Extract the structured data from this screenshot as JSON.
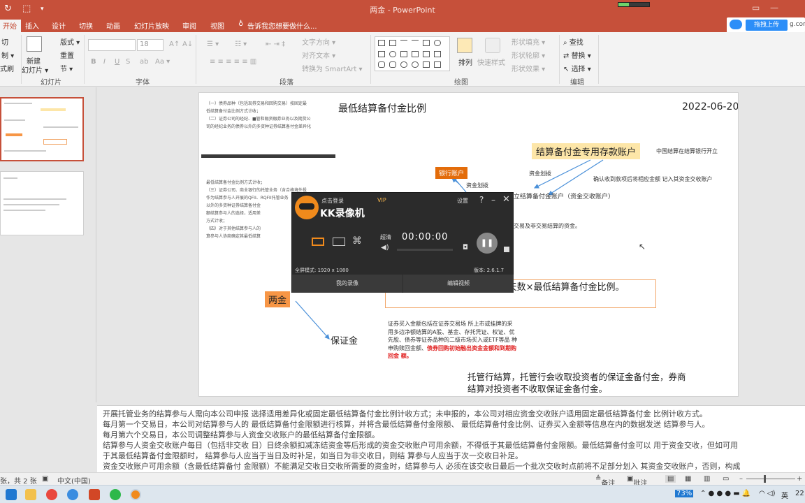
{
  "window": {
    "title": "两金 - PowerPoint",
    "minimize_icon": "minimize-icon",
    "maximize_icon": "maximize-icon",
    "close_icon": "close-icon"
  },
  "ribbon_tabs": [
    "开始",
    "插入",
    "设计",
    "切换",
    "动画",
    "幻灯片放映",
    "审阅",
    "视图"
  ],
  "tell_me": "告诉我您想要做什么...",
  "upload_button": "拖拽上传",
  "upload_suffix": "g.com",
  "ribbon": {
    "clipboard": [
      "切",
      "制 ▾",
      "式刷"
    ],
    "new_slide": "新建",
    "new_slide_sub": "幻灯片 ▾",
    "layout": "版式 ▾",
    "reset": "重置",
    "section": "节 ▾",
    "slides_group": "幻灯片",
    "font_size": "18",
    "font_group": "字体",
    "text_direction": "文字方向 ▾",
    "align_text": "对齐文本 ▾",
    "smartart": "转换为 SmartArt ▾",
    "paragraph_group": "段落",
    "arrange": "排列",
    "quick_styles": "快速样式",
    "shape_fill": "形状填充 ▾",
    "shape_outline": "形状轮廓 ▾",
    "shape_effects": "形状效果 ▾",
    "drawing_group": "绘图",
    "find": "查找",
    "replace": "替换 ▾",
    "select": "选择 ▾",
    "editing_group": "编辑",
    "bold": "B",
    "italic": "I",
    "underline": "U",
    "strike": "S",
    "spacing": "ab",
    "case": "Aa ▾"
  },
  "slide": {
    "title": "最低结算备付金比例",
    "date": "2022-06-20",
    "top_left_lines": [
      "（一）债券品种（包括现券交易和回购交易）按固定最",
      "低结算备付金比例方式计收；",
      "（二）证券公司的经纪、■管和融资融券业务以及期货公",
      "司的经纪业务的债券以外的多资种证券结算备付金差异化"
    ],
    "mid_left_lines": [
      "最低结算备付金比例方式计收；",
      "（三）证券公司、商业银行的托管业务（含合格境外投",
      "作为结算参与人开展的QFII、RQFII托管业务",
      "以外的多资种证券结算备付金",
      "额结算参与人的选择，适用差",
      "方式计收；",
      "（四）对于其他结算参与人的",
      "算参与人协商确定其最低结算"
    ],
    "main_box": "结算备付金专用存款账户",
    "right_note_1": "中国结算在结算银行开立",
    "right_note_2": "确认收到款项后将相应金额 记入其资金交收账户",
    "bank_account": "银行账户",
    "fund_transfer_1": "资金划拨",
    "fund_transfer_2": "资金划拨",
    "settlement_account": "立结算备付金账户（资金交收账户）",
    "settlement_note": "交易及非交易结算的资金。",
    "deposit": "两金",
    "formula": "证券买入金额 / 上月交易日历天数×最低结算备付金比例。",
    "margin": "保证金",
    "purchase_note_lines": [
      "证券买入金额包括在证券交易场 所上市或挂牌的采",
      "用多边净额结算的A股、基金、存托凭证、权证、优",
      "先股、债券等证券品种的二级市场买入或ETF等品 种",
      "申购赎回金额、"
    ],
    "purchase_note_red": "债券回购初始融出资金金额和到期购",
    "purchase_note_red_2": "回金 额。",
    "custody_note_lines": [
      "托管行结算，托管行会收取投资者的保证金备付金，券商",
      "结算对投资者不收取保证金备付金。"
    ]
  },
  "recorder": {
    "login": "点击登录",
    "vip": "VIP",
    "settings": "设置",
    "help": "?",
    "name": "KK录像机",
    "quality": "超清",
    "time": "00:00:00",
    "mode": "全屏模式: 1920 x 1080",
    "version": "版本: 2.6.1.7",
    "my_recordings": "我的录像",
    "edit_video": "编辑视频"
  },
  "notes": [
    "开展托管业务的结算参与人需向本公司申报 选择适用差异化或固定最低结算备付金比例计收方式；未申报的，本公司对相应资金交收账户适用固定最低结算备付金 比例计收方式。",
    "每月第一个交易日，本公司对结算参与人的 最低结算备付金限额进行核算，并将含最低结算备付金限额、 最低结算备付金比例、证券买入金额等信息在内的数据发送 结算参与人。",
    "每月第六个交易日，本公司调整结算参与人资金交收账户的最低结算备付金限额。",
    "结算参与人资金交收账户每日（包括非交收 日）日终余额扣减冻结资金等后形成的资金交收账户可用余额，不得低于其最低结算备付金限额。最低结算备付金可以 用于资金交收，但如可用",
    "于其最低结算备付金限额时， 结算参与人应当于当日及时补足，如当日为非交收日，则结 算参与人应当于次一交收日补足。",
    "资金交收账户可用余额（含最低结算备付 金限额）不能满足交收日交收所需要的资金时，结算参与人 必须在该交收日最后一个批次交收时点前将不足部分划入 其资金交收账户，否则，构成"
  ],
  "statusbar": {
    "slide_count": "张，共 2 张",
    "language": "中文(中国)",
    "notes_btn": "备注",
    "comments_btn": "批注"
  },
  "taskbar": {
    "battery": "73%",
    "ime": "英",
    "clock": "22"
  }
}
